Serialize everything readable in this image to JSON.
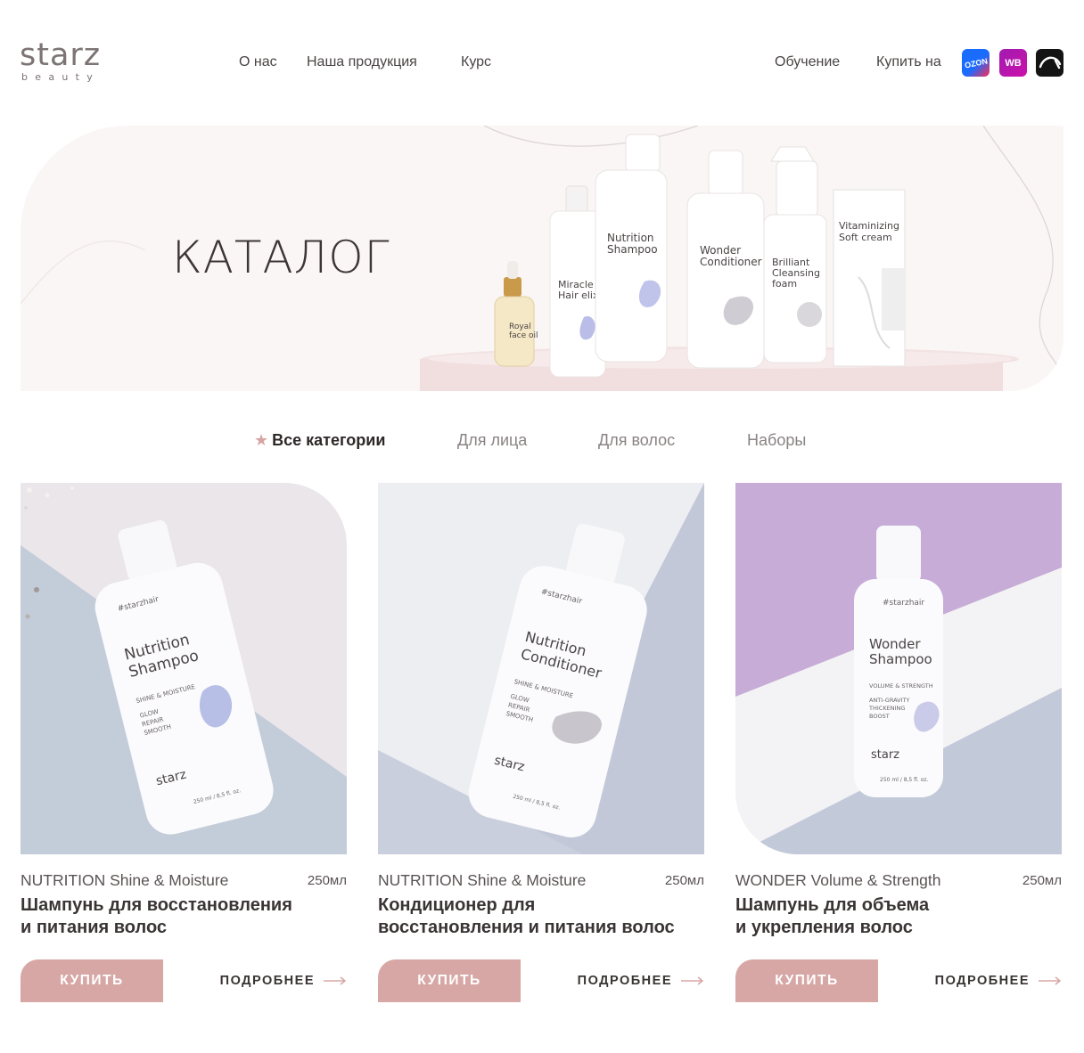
{
  "header": {
    "logo_main": "starz",
    "logo_sub": "beauty",
    "nav_left": [
      "О нас",
      "Наша продукция",
      "Курс"
    ],
    "nav_right": [
      "Обучение",
      "Купить на"
    ],
    "marketplaces": [
      {
        "icon": "ozon-icon",
        "label": "OZON",
        "color": "#1a6cff"
      },
      {
        "icon": "wildberries-icon",
        "label": "WB",
        "color": "#cb11ab"
      },
      {
        "icon": "yandex-market-icon",
        "label": "",
        "color": "#141414"
      }
    ]
  },
  "hero": {
    "title": "КАТАЛОГ",
    "products": [
      {
        "name_line1": "Royal",
        "name_line2": "face oil",
        "name_line3": ""
      },
      {
        "name_line1": "Miracle",
        "name_line2": "Hair elixir",
        "name_line3": ""
      },
      {
        "name_line1": "Nutrition",
        "name_line2": "Shampoo",
        "name_line3": ""
      },
      {
        "name_line1": "Wonder",
        "name_line2": "Conditioner",
        "name_line3": ""
      },
      {
        "name_line1": "Brilliant",
        "name_line2": "Cleansing",
        "name_line3": "foam"
      },
      {
        "name_line1": "Vitaminizing",
        "name_line2": "Soft cream",
        "name_line3": ""
      }
    ]
  },
  "tabs": [
    {
      "label": "Все категории",
      "active": true
    },
    {
      "label": "Для лица",
      "active": false
    },
    {
      "label": "Для волос",
      "active": false
    },
    {
      "label": "Наборы",
      "active": false
    }
  ],
  "products": [
    {
      "line": "NUTRITION Shine & Moisture",
      "volume": "250мл",
      "title_line1": "Шампунь для восстановления",
      "title_line2": "и питания волос",
      "buy_label": "КУПИТЬ",
      "more_label": "ПОДРОБНЕЕ",
      "bottle_name_1": "Nutrition",
      "bottle_name_2": "Shampoo",
      "bottle_tag": "#starzhair",
      "bottle_sub": "SHINE & MOISTURE",
      "bottle_benefits": [
        "GLOW",
        "REPAIR",
        "SMOOTH"
      ],
      "bottle_brand": "starz",
      "bottle_volume": "250 ml / 8,5 fl. oz.",
      "swatch_color": "#b7bfe6"
    },
    {
      "line": "NUTRITION Shine & Moisture",
      "volume": "250мл",
      "title_line1": "Кондиционер для",
      "title_line2": "восстановления и питания волос",
      "buy_label": "КУПИТЬ",
      "more_label": "ПОДРОБНЕЕ",
      "bottle_name_1": "Nutrition",
      "bottle_name_2": "Conditioner",
      "bottle_tag": "#starzhair",
      "bottle_sub": "SHINE & MOISTURE",
      "bottle_benefits": [
        "GLOW",
        "REPAIR",
        "SMOOTH"
      ],
      "bottle_brand": "starz",
      "bottle_volume": "250 ml / 8,5 fl. oz.",
      "swatch_color": "#c8c6cc"
    },
    {
      "line": "WONDER Volume & Strength",
      "volume": "250мл",
      "title_line1": "Шампунь для объема",
      "title_line2": "и укрепления волос",
      "buy_label": "КУПИТЬ",
      "more_label": "ПОДРОБНЕЕ",
      "bottle_name_1": "Wonder",
      "bottle_name_2": "Shampoo",
      "bottle_tag": "#starzhair",
      "bottle_sub": "VOLUME & STRENGTH",
      "bottle_benefits": [
        "ANTI-GRAVITY",
        "THICKENING",
        "BOOST"
      ],
      "bottle_brand": "starz",
      "bottle_volume": "250 ml / 8,5 fl. oz.",
      "swatch_color": "#c9cbe8"
    }
  ],
  "colors": {
    "accent": "#d7a7a6",
    "text": "#3a3434",
    "hero_bg": "#faf6f5"
  }
}
